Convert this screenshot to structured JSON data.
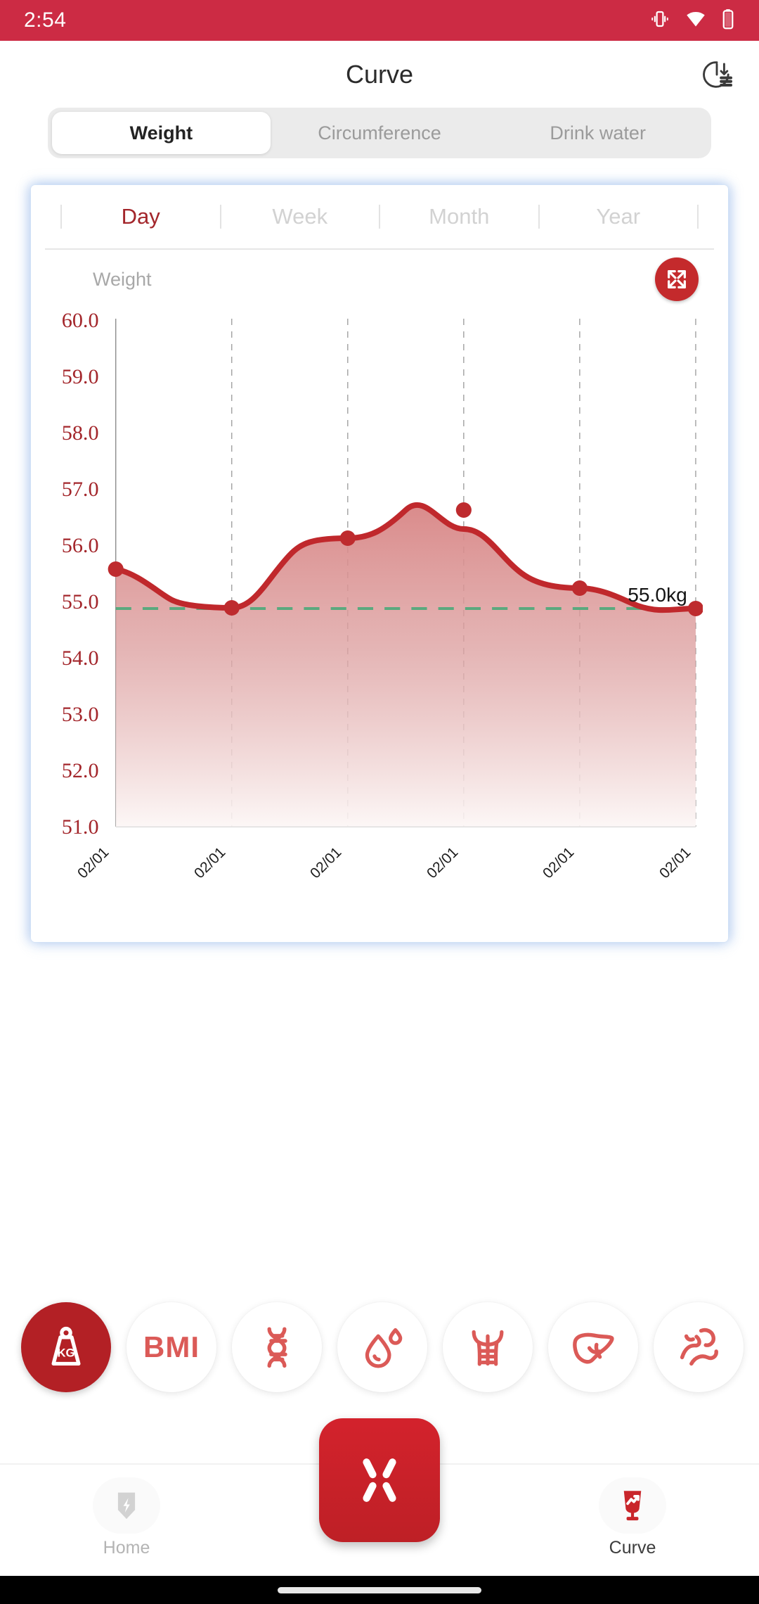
{
  "status_bar": {
    "time": "2:54",
    "background": "#CC2B44",
    "icons": [
      "vibrate-icon",
      "wifi-icon",
      "battery-icon"
    ]
  },
  "header": {
    "title": "Curve",
    "action_icon": "history-clock-icon"
  },
  "tabs": [
    {
      "label": "Weight",
      "active": true
    },
    {
      "label": "Circumference",
      "active": false
    },
    {
      "label": "Drink water",
      "active": false
    }
  ],
  "periods": [
    {
      "label": "Day",
      "active": true
    },
    {
      "label": "Week",
      "active": false
    },
    {
      "label": "Month",
      "active": false
    },
    {
      "label": "Year",
      "active": false
    }
  ],
  "chart_card": {
    "metric_label": "Weight",
    "expand_icon": "fullscreen-expand-icon",
    "expand_color": "#C42A2C"
  },
  "chart_data": {
    "type": "area",
    "title": "Weight",
    "xlabel": "",
    "ylabel": "Weight",
    "unit": "kg",
    "categories": [
      "02/01",
      "02/01",
      "02/01",
      "02/01",
      "02/01",
      "02/01"
    ],
    "values": [
      55.3,
      55.05,
      55.75,
      56.2,
      55.6,
      55.0
    ],
    "ylim": [
      51.0,
      60.0
    ],
    "yticks": [
      "60.0",
      "59.0",
      "58.0",
      "57.0",
      "56.0",
      "55.0",
      "54.0",
      "53.0",
      "52.0",
      "51.0"
    ],
    "ytick_values": [
      60.0,
      59.0,
      58.0,
      57.0,
      56.0,
      55.0,
      54.0,
      53.0,
      52.0,
      51.0
    ],
    "grid": "vertical-dashed",
    "legend": "none",
    "annotations": [
      {
        "text": "55.0kg",
        "value": 55.0,
        "at_index": 5
      }
    ],
    "target_line": {
      "value": 55.0,
      "style": "dashed",
      "color": "#5AA97E"
    },
    "line_color": "#C0282C",
    "point_color": "#BE2B2E",
    "fill_gradient_top": "#D98A8A",
    "fill_gradient_bottom": "#FDF7F6",
    "axis_label_color": "#A3262B"
  },
  "metrics": [
    {
      "name": "weight-kg",
      "icon": "weight-kg-icon",
      "label": "",
      "active": true
    },
    {
      "name": "bmi",
      "icon": "bmi-text-icon",
      "label": "BMI",
      "active": false
    },
    {
      "name": "body-fat",
      "icon": "dna-helix-icon",
      "label": "",
      "active": false
    },
    {
      "name": "water",
      "icon": "water-drop-icon",
      "label": "",
      "active": false
    },
    {
      "name": "muscle",
      "icon": "torso-muscle-icon",
      "label": "",
      "active": false
    },
    {
      "name": "visceral-fat",
      "icon": "liver-icon",
      "label": "",
      "active": false
    },
    {
      "name": "bone-muscle",
      "icon": "muscle-fiber-icon",
      "label": "",
      "active": false
    }
  ],
  "bottom_nav": [
    {
      "label": "Home",
      "icon": "shield-bolt-icon",
      "active": false
    },
    {
      "label": "Curve",
      "icon": "chart-trophy-icon",
      "active": true
    }
  ],
  "fab": {
    "icon": "scan-corners-icon",
    "color": "#C62028"
  }
}
